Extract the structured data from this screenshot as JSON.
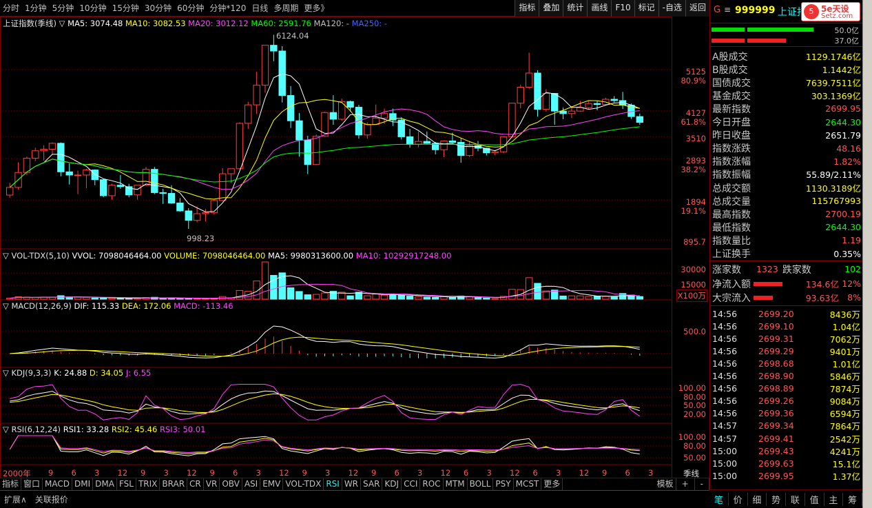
{
  "toolbar": {
    "periods": [
      "分时",
      "1分钟",
      "5分钟",
      "10分钟",
      "15分钟",
      "30分钟",
      "60分钟",
      "分钟*120",
      "日线",
      "多周期",
      "更多》"
    ],
    "right_buttons": [
      "指标",
      "叠加",
      "统计",
      "画线",
      "F10",
      "标记",
      "-自选",
      "返回"
    ]
  },
  "main_chart": {
    "title": "上证指数(季线) ▽",
    "ma5": "MA5: 3074.48",
    "ma10": "MA10: 3082.53",
    "ma20": "MA20: 3012.12",
    "ma60": "MA60: 2591.76",
    "ma120": "MA120: -",
    "ma250": "MA250: -",
    "high_label": "6124.04",
    "low_label": "998.23",
    "axis": [
      {
        "v": "5125",
        "p": "80.9%"
      },
      {
        "v": "4127",
        "p": "61.8%"
      },
      {
        "v": "3510",
        "p": ""
      },
      {
        "v": "2893",
        "p": "38.2%"
      },
      {
        "v": "1894",
        "p": "19.1%"
      },
      {
        "v": "895.7",
        "p": ""
      }
    ]
  },
  "vol_panel": {
    "title": "▽ VOL-TDX(5,10)",
    "vvol": "VVOL: 7098046464.00",
    "volume": "VOLUME: 7098046464.00",
    "ma5": "MA5: 9980313600.00",
    "ma10": "MA10: 10292917248.00",
    "axis": [
      "30000",
      "15000"
    ],
    "unit": "X100万"
  },
  "macd_panel": {
    "title": "▽ MACD(12,26,9)",
    "dif": "DIF: 115.33",
    "dea": "DEA: 172.06",
    "macd": "MACD: -113.46",
    "axis": [
      "500.0"
    ]
  },
  "kdj_panel": {
    "title": "▽ KDJ(9,3,3)",
    "k": "K: 24.88",
    "d": "D: 34.05",
    "j": "J: 6.55",
    "axis": [
      "100.00",
      "80.00",
      "50.00",
      "20.00"
    ]
  },
  "rsi_panel": {
    "title": "▽ RSI(6,12,24)",
    "rsi1": "RSI1: 33.28",
    "rsi2": "RSI2: 45.46",
    "rsi3": "RSI3: 50.01",
    "axis": [
      "100.00",
      "80.00",
      "50.00"
    ]
  },
  "xaxis": {
    "year": "2000年",
    "ticks": [
      "9",
      "6",
      "3",
      "12",
      "9",
      "3",
      "12",
      "9",
      "6",
      "3",
      "12",
      "9",
      "3",
      "12",
      "9",
      "6",
      "3",
      "12",
      "6",
      "3",
      "12",
      "6",
      "3",
      "12",
      "9",
      "6",
      "3"
    ],
    "period": "季线"
  },
  "bottom_tabs": [
    "指标",
    "窗口",
    "MACD",
    "DMI",
    "DMA",
    "FSL",
    "TRIX",
    "BRAR",
    "CR",
    "VR",
    "OBV",
    "ASI",
    "EMV",
    "VOL-TDX",
    "RSI",
    "WR",
    "SAR",
    "KDJ",
    "CCI",
    "ROC",
    "MTM",
    "BOLL",
    "PSY",
    "MCST",
    "更多"
  ],
  "bottom_right": [
    "模板",
    "+",
    "-"
  ],
  "status_items": [
    "扩展∧",
    "关联报价"
  ],
  "quote": {
    "code": "999999",
    "name": "上证指数",
    "logo": "5e天设",
    "site": "Setz.com",
    "ratio_top": "50.0亿",
    "ratio_bot": "37.0亿",
    "rows": [
      {
        "k": "A股成交",
        "v": "1129.1746亿",
        "c": "#ffff00"
      },
      {
        "k": "B股成交",
        "v": "1.1442亿",
        "c": "#ffff00"
      },
      {
        "k": "国债成交",
        "v": "7639.7511亿",
        "c": "#ffff00"
      },
      {
        "k": "基金成交",
        "v": "303.1369亿",
        "c": "#ffff00"
      },
      {
        "k": "最新指数",
        "v": "2699.95",
        "c": "#ff5555"
      },
      {
        "k": "今日开盘",
        "v": "2644.30",
        "c": "#00ff00"
      },
      {
        "k": "昨日收盘",
        "v": "2651.79",
        "c": "#ffffff"
      },
      {
        "k": "指数涨跌",
        "v": "48.16",
        "c": "#ff5555"
      },
      {
        "k": "指数涨幅",
        "v": "1.82%",
        "c": "#ff5555"
      },
      {
        "k": "指数振幅",
        "v": "55.89/2.11%",
        "c": "#ffffff"
      },
      {
        "k": "总成交额",
        "v": "1130.3189亿",
        "c": "#ffff00"
      },
      {
        "k": "总成交量",
        "v": "115767993",
        "c": "#ffff00"
      },
      {
        "k": "最高指数",
        "v": "2700.19",
        "c": "#ff5555"
      },
      {
        "k": "最低指数",
        "v": "2644.30",
        "c": "#00ff00"
      },
      {
        "k": "指数量比",
        "v": "1.19",
        "c": "#ff5555"
      },
      {
        "k": "上证换手",
        "v": "0.35%",
        "c": "#ffffff"
      }
    ],
    "up_label": "涨家数",
    "up": "1323",
    "down_label": "跌家数",
    "down": "102",
    "inflow_label": "净流入额",
    "inflow": "134.6亿",
    "inflow_pct": "12%",
    "block_label": "大宗流入",
    "block": "93.63亿",
    "block_pct": "8%",
    "ticks": [
      {
        "t": "14:56",
        "p": "2699.20",
        "q": "8436万"
      },
      {
        "t": "14:56",
        "p": "2699.10",
        "q": "1.04亿"
      },
      {
        "t": "14:56",
        "p": "2699.31",
        "q": "7062万"
      },
      {
        "t": "14:56",
        "p": "2699.29",
        "q": "9401万"
      },
      {
        "t": "14:56",
        "p": "2698.68",
        "q": "1.01亿"
      },
      {
        "t": "14:56",
        "p": "2698.90",
        "q": "5846万"
      },
      {
        "t": "14:56",
        "p": "2698.89",
        "q": "7874万"
      },
      {
        "t": "14:56",
        "p": "2699.26",
        "q": "9084万"
      },
      {
        "t": "14:56",
        "p": "2699.36",
        "q": "6594万"
      },
      {
        "t": "14:57",
        "p": "2699.34",
        "q": "7864万"
      },
      {
        "t": "14:57",
        "p": "2699.41",
        "q": "2542万"
      },
      {
        "t": "15:00",
        "p": "2699.43",
        "q": "4241万"
      },
      {
        "t": "15:00",
        "p": "2699.63",
        "q": "15.1亿"
      },
      {
        "t": "15:00",
        "p": "2699.95",
        "q": "1.37亿"
      }
    ],
    "tabs": [
      "笔",
      "价",
      "细",
      "势",
      "联",
      "值",
      "主",
      "筹"
    ]
  },
  "chart_data": {
    "type": "candlestick",
    "title": "上证指数(季线)",
    "period": "quarterly",
    "high": 6124.04,
    "low": 998.23,
    "candles": [
      [
        2000,
        1,
        1368,
        1535,
        1335,
        1470
      ],
      [
        2000,
        2,
        1470,
        1860,
        1440,
        1690
      ],
      [
        2000,
        3,
        1690,
        1960,
        1650,
        1930
      ],
      [
        2000,
        4,
        1930,
        2130,
        1880,
        2070
      ],
      [
        2001,
        1,
        2070,
        2180,
        1890,
        2100
      ],
      [
        2001,
        2,
        2100,
        2240,
        2000,
        2220
      ],
      [
        2001,
        3,
        2220,
        2240,
        1630,
        1700
      ],
      [
        2001,
        4,
        1700,
        1840,
        1510,
        1650
      ],
      [
        2002,
        1,
        1650,
        1720,
        1380,
        1650
      ],
      [
        2002,
        2,
        1650,
        1750,
        1460,
        1730
      ],
      [
        2002,
        3,
        1730,
        1740,
        1500,
        1580
      ],
      [
        2002,
        4,
        1580,
        1590,
        1340,
        1360
      ],
      [
        2003,
        1,
        1360,
        1520,
        1310,
        1500
      ],
      [
        2003,
        2,
        1500,
        1650,
        1450,
        1480
      ],
      [
        2003,
        3,
        1480,
        1520,
        1340,
        1370
      ],
      [
        2003,
        4,
        1370,
        1500,
        1310,
        1500
      ],
      [
        2004,
        1,
        1500,
        1780,
        1490,
        1740
      ],
      [
        2004,
        2,
        1740,
        1780,
        1380,
        1400
      ],
      [
        2004,
        3,
        1400,
        1450,
        1260,
        1390
      ],
      [
        2004,
        4,
        1390,
        1500,
        1260,
        1270
      ],
      [
        2005,
        1,
        1270,
        1330,
        1170,
        1180
      ],
      [
        2005,
        2,
        1180,
        1210,
        998,
        1080
      ],
      [
        2005,
        3,
        1080,
        1230,
        1060,
        1150
      ],
      [
        2005,
        4,
        1150,
        1200,
        1070,
        1160
      ],
      [
        2006,
        1,
        1160,
        1320,
        1140,
        1300
      ],
      [
        2006,
        2,
        1300,
        1760,
        1290,
        1670
      ],
      [
        2006,
        3,
        1670,
        1750,
        1530,
        1750
      ],
      [
        2006,
        4,
        1750,
        2700,
        1740,
        2675
      ],
      [
        2007,
        1,
        2675,
        3270,
        2540,
        3180
      ],
      [
        2007,
        2,
        3180,
        4330,
        2920,
        3820
      ],
      [
        2007,
        3,
        3820,
        5550,
        3560,
        5550
      ],
      [
        2007,
        4,
        5550,
        6124,
        4780,
        5260
      ],
      [
        2008,
        1,
        5260,
        5500,
        3250,
        3470
      ],
      [
        2008,
        2,
        3470,
        3790,
        2560,
        2740
      ],
      [
        2008,
        3,
        2740,
        2950,
        1960,
        2290
      ],
      [
        2008,
        4,
        2290,
        2380,
        1664,
        1820
      ],
      [
        2009,
        1,
        1820,
        2410,
        1810,
        2370
      ],
      [
        2009,
        2,
        2370,
        2980,
        2360,
        2960
      ],
      [
        2009,
        3,
        2960,
        3480,
        2640,
        2780
      ],
      [
        2009,
        4,
        2780,
        3370,
        2740,
        3280
      ],
      [
        2010,
        1,
        3280,
        3310,
        2990,
        3110
      ],
      [
        2010,
        2,
        3110,
        3180,
        2320,
        2400
      ],
      [
        2010,
        3,
        2400,
        2700,
        2320,
        2650
      ],
      [
        2010,
        4,
        2650,
        3190,
        2650,
        2810
      ],
      [
        2011,
        1,
        2810,
        3070,
        2660,
        2930
      ],
      [
        2011,
        2,
        2930,
        3070,
        2610,
        2760
      ],
      [
        2011,
        3,
        2760,
        2830,
        2300,
        2360
      ],
      [
        2011,
        4,
        2360,
        2540,
        2130,
        2200
      ],
      [
        2012,
        1,
        2200,
        2480,
        2140,
        2260
      ],
      [
        2012,
        2,
        2260,
        2480,
        2210,
        2220
      ],
      [
        2012,
        3,
        2220,
        2250,
        2000,
        2090
      ],
      [
        2012,
        4,
        2090,
        2280,
        1950,
        2270
      ],
      [
        2013,
        1,
        2270,
        2450,
        2210,
        2240
      ],
      [
        2013,
        2,
        2240,
        2330,
        1850,
        1980
      ],
      [
        2013,
        3,
        1980,
        2270,
        1950,
        2170
      ],
      [
        2013,
        4,
        2170,
        2270,
        2060,
        2120
      ],
      [
        2014,
        1,
        2120,
        2130,
        1980,
        2030
      ],
      [
        2014,
        2,
        2030,
        2090,
        1990,
        2050
      ],
      [
        2014,
        3,
        2050,
        2370,
        2020,
        2360
      ],
      [
        2014,
        4,
        2360,
        3240,
        2340,
        3230
      ],
      [
        2015,
        1,
        3230,
        3840,
        3080,
        3750
      ],
      [
        2015,
        2,
        3750,
        5180,
        3690,
        4280
      ],
      [
        2015,
        3,
        4280,
        4390,
        2850,
        3050
      ],
      [
        2015,
        4,
        3050,
        3680,
        2990,
        3540
      ],
      [
        2016,
        1,
        3540,
        3540,
        2640,
        3000
      ],
      [
        2016,
        2,
        3000,
        3100,
        2780,
        2930
      ],
      [
        2016,
        3,
        2930,
        3140,
        2810,
        3000
      ],
      [
        2016,
        4,
        3000,
        3300,
        2980,
        3100
      ],
      [
        2017,
        1,
        3100,
        3290,
        3040,
        3220
      ],
      [
        2017,
        2,
        3220,
        3300,
        3020,
        3190
      ],
      [
        2017,
        3,
        3190,
        3400,
        3160,
        3350
      ],
      [
        2017,
        4,
        3350,
        3450,
        3250,
        3310
      ],
      [
        2018,
        1,
        3310,
        3590,
        3060,
        3170
      ],
      [
        2018,
        2,
        3170,
        3220,
        2790,
        2850
      ],
      [
        2018,
        3,
        2850,
        2930,
        2640,
        2700
      ]
    ]
  }
}
